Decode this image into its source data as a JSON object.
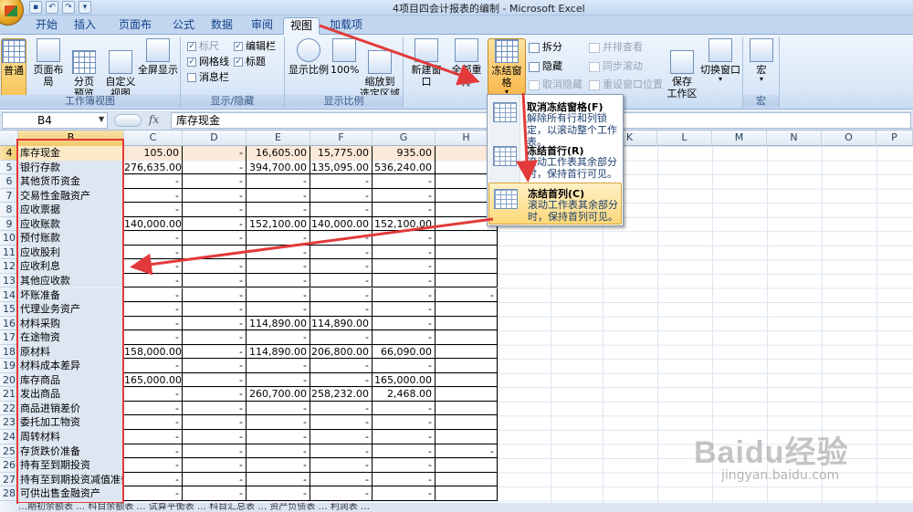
{
  "window": {
    "title": "4项目四会计报表的编制 - Microsoft Excel"
  },
  "tabs": [
    "开始",
    "插入",
    "页面布局",
    "公式",
    "数据",
    "审阅",
    "视图",
    "加载项"
  ],
  "active_tab": "视图",
  "ribbon": {
    "workbook_views": {
      "label": "工作簿视图",
      "buttons": [
        "普通",
        "页面布局",
        "分页\n预览",
        "自定义\n视图",
        "全屏显示"
      ]
    },
    "show_hide": {
      "label": "显示/隐藏",
      "checks": [
        {
          "text": "标尺",
          "checked": true,
          "disabled": true
        },
        {
          "text": "编辑栏",
          "checked": true,
          "disabled": false
        },
        {
          "text": "网格线",
          "checked": true,
          "disabled": false
        },
        {
          "text": "标题",
          "checked": true,
          "disabled": false
        },
        {
          "text": "消息栏",
          "checked": false,
          "disabled": false
        }
      ]
    },
    "zoom": {
      "label": "显示比例",
      "buttons": [
        "显示比例",
        "100%",
        "缩放到\n选定区域"
      ]
    },
    "window": {
      "label": "",
      "buttons": [
        "新建窗口",
        "全部重排",
        "冻结窗格"
      ],
      "small": [
        {
          "text": "拆分",
          "disabled": false
        },
        {
          "text": "隐藏",
          "disabled": false
        },
        {
          "text": "取消隐藏",
          "disabled": true
        },
        {
          "text": "并排查看",
          "disabled": true
        },
        {
          "text": "同步滚动",
          "disabled": true
        },
        {
          "text": "重设窗口位置",
          "disabled": true
        }
      ],
      "save_workspace": "保存\n工作区",
      "switch_window": "切换窗口"
    },
    "macros": {
      "label": "宏",
      "button": "宏"
    }
  },
  "formula_bar": {
    "name_box": "B4",
    "fx": "fx",
    "content": "库存现金"
  },
  "columns": [
    {
      "id": "B",
      "sel": true
    },
    {
      "id": "C"
    },
    {
      "id": "D"
    },
    {
      "id": "E"
    },
    {
      "id": "F"
    },
    {
      "id": "G"
    },
    {
      "id": "H"
    },
    {
      "id": "I"
    },
    {
      "id": "J"
    },
    {
      "id": "K"
    },
    {
      "id": "L"
    },
    {
      "id": "M"
    },
    {
      "id": "N"
    },
    {
      "id": "O"
    },
    {
      "id": "P"
    }
  ],
  "rows": [
    {
      "n": "4",
      "b": "库存现金",
      "c": "105.00",
      "d": "-",
      "e": "16,605.00",
      "f": "15,775.00",
      "g": "935.00"
    },
    {
      "n": "5",
      "b": "银行存款",
      "c": "276,635.00",
      "d": "-",
      "e": "394,700.00",
      "f": "135,095.00",
      "g": "536,240.00"
    },
    {
      "n": "6",
      "b": "其他货币资金",
      "c": "-",
      "d": "-",
      "e": "-",
      "f": "-",
      "g": "-"
    },
    {
      "n": "7",
      "b": "交易性金融资产",
      "c": "-",
      "d": "-",
      "e": "-",
      "f": "-",
      "g": "-"
    },
    {
      "n": "8",
      "b": "应收票据",
      "c": "-",
      "d": "-",
      "e": "-",
      "f": "-",
      "g": "-"
    },
    {
      "n": "9",
      "b": "应收账款",
      "c": "140,000.00",
      "d": "-",
      "e": "152,100.00",
      "f": "140,000.00",
      "g": "152,100.00"
    },
    {
      "n": "10",
      "b": "预付账款",
      "c": "-",
      "d": "-",
      "e": "-",
      "f": "-",
      "g": "-"
    },
    {
      "n": "11",
      "b": "应收股利",
      "c": "-",
      "d": "-",
      "e": "-",
      "f": "-",
      "g": "-"
    },
    {
      "n": "12",
      "b": "应收利息",
      "c": "-",
      "d": "-",
      "e": "-",
      "f": "-",
      "g": "-"
    },
    {
      "n": "13",
      "b": "其他应收款",
      "c": "-",
      "d": "-",
      "e": "-",
      "f": "-",
      "g": "-"
    },
    {
      "n": "14",
      "b": "坏账准备",
      "c": "-",
      "d": "-",
      "e": "-",
      "f": "-",
      "g": "-"
    },
    {
      "n": "15",
      "b": "代理业务资产",
      "c": "-",
      "d": "-",
      "e": "-",
      "f": "-",
      "g": "-"
    },
    {
      "n": "16",
      "b": "材料采购",
      "c": "-",
      "d": "-",
      "e": "114,890.00",
      "f": "114,890.00",
      "g": "-"
    },
    {
      "n": "17",
      "b": "在途物资",
      "c": "-",
      "d": "-",
      "e": "-",
      "f": "-",
      "g": "-"
    },
    {
      "n": "18",
      "b": "原材料",
      "c": "158,000.00",
      "d": "-",
      "e": "114,890.00",
      "f": "206,800.00",
      "g": "66,090.00"
    },
    {
      "n": "19",
      "b": "材料成本差异",
      "c": "-",
      "d": "-",
      "e": "-",
      "f": "-",
      "g": "-"
    },
    {
      "n": "20",
      "b": "库存商品",
      "c": "165,000.00",
      "d": "-",
      "e": "-",
      "f": "-",
      "g": "165,000.00"
    },
    {
      "n": "21",
      "b": "发出商品",
      "c": "-",
      "d": "-",
      "e": "260,700.00",
      "f": "258,232.00",
      "g": "2,468.00"
    },
    {
      "n": "22",
      "b": "商品进销差价",
      "c": "-",
      "d": "-",
      "e": "-",
      "f": "-",
      "g": "-"
    },
    {
      "n": "23",
      "b": "委托加工物资",
      "c": "-",
      "d": "-",
      "e": "-",
      "f": "-",
      "g": "-"
    },
    {
      "n": "24",
      "b": "周转材料",
      "c": "-",
      "d": "-",
      "e": "-",
      "f": "-",
      "g": "-"
    },
    {
      "n": "25",
      "b": "存货跌价准备",
      "c": "-",
      "d": "-",
      "e": "-",
      "f": "-",
      "g": "-"
    },
    {
      "n": "26",
      "b": "持有至到期投资",
      "c": "-",
      "d": "-",
      "e": "-",
      "f": "-",
      "g": "-"
    },
    {
      "n": "27",
      "b": "持有至到期投资减值准备",
      "c": "-",
      "d": "-",
      "e": "-",
      "f": "-",
      "g": "-"
    },
    {
      "n": "28",
      "b": "可供出售金融资产",
      "c": "-",
      "d": "-",
      "e": "-",
      "f": "-",
      "g": "-"
    }
  ],
  "h_marks": {
    "14": "-",
    "25": "-"
  },
  "freeze_menu": [
    {
      "title": "取消冻结窗格(F)",
      "desc": "解除所有行和列锁定，以滚动整个工作表。"
    },
    {
      "title": "冻结首行(R)",
      "desc": "滚动工作表其余部分时，保持首行可见。"
    },
    {
      "title": "冻结首列(C)",
      "desc": "滚动工作表其余部分时，保持首列可见。"
    }
  ],
  "watermark": {
    "logo": "Baidu经验",
    "url": "jingyan.baidu.com"
  },
  "sheet_tabs_text": "…期初余额表 … 科目余额表 … 试算平衡表 … 科目汇总表 … 资产负债表 … 利润表 …"
}
